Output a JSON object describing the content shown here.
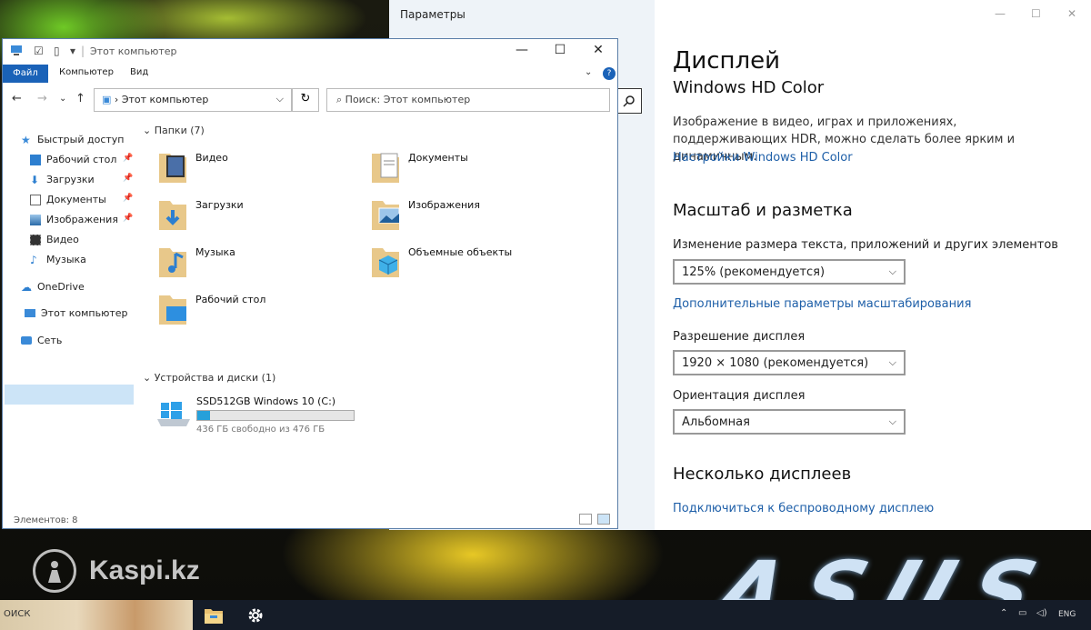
{
  "watermark": {
    "text": "Kaspi.kz"
  },
  "settings": {
    "window_title": "Параметры",
    "heading": "Дисплей",
    "subheading": "Windows HD Color",
    "description": "Изображение в видео, играх и приложениях, поддерживающих HDR, можно сделать более ярким и динамичным.",
    "hd_color_link": "Настройки Windows HD Color",
    "scale_heading": "Масштаб и разметка",
    "scale_label": "Изменение размера текста, приложений и других элементов",
    "scale_value": "125% (рекомендуется)",
    "advanced_scaling_link": "Дополнительные параметры масштабирования",
    "resolution_label": "Разрешение дисплея",
    "resolution_value": "1920 × 1080 (рекомендуется)",
    "orientation_label": "Ориентация дисплея",
    "orientation_value": "Альбомная",
    "multi_heading": "Несколько дисплеев",
    "wireless_link": "Подключиться к беспроводному дисплею"
  },
  "explorer": {
    "title": "Этот компьютер",
    "ribbon_tabs": [
      "Файл",
      "Компьютер",
      "Вид"
    ],
    "address": "Этот компьютер",
    "search_placeholder": "Поиск: Этот компьютер",
    "nav": {
      "quick_access": "Быстрый доступ",
      "desktop": "Рабочий стол",
      "downloads": "Загрузки",
      "documents": "Документы",
      "pictures": "Изображения",
      "videos": "Видео",
      "music": "Музыка",
      "onedrive": "OneDrive",
      "this_pc": "Этот компьютер",
      "network": "Сеть"
    },
    "folders_header": "Папки (7)",
    "folders": {
      "videos": "Видео",
      "documents": "Документы",
      "downloads": "Загрузки",
      "pictures": "Изображения",
      "music": "Музыка",
      "objects3d": "Объемные объекты",
      "desktop": "Рабочий стол"
    },
    "drives_header": "Устройства и диски (1)",
    "drive": {
      "name": "SSD512GB Windows 10  (C:)",
      "free_text": "436 ГБ свободно из 476 ГБ",
      "used_fraction": 0.084
    },
    "status": "Элементов: 8"
  },
  "taskbar": {
    "search_text": "ОИСК",
    "language": "ENG"
  },
  "colors": {
    "accent": "#1a62b8",
    "link": "#1e5fa8",
    "drive_fill": "#26a0da",
    "taskbar": "#151c28"
  }
}
